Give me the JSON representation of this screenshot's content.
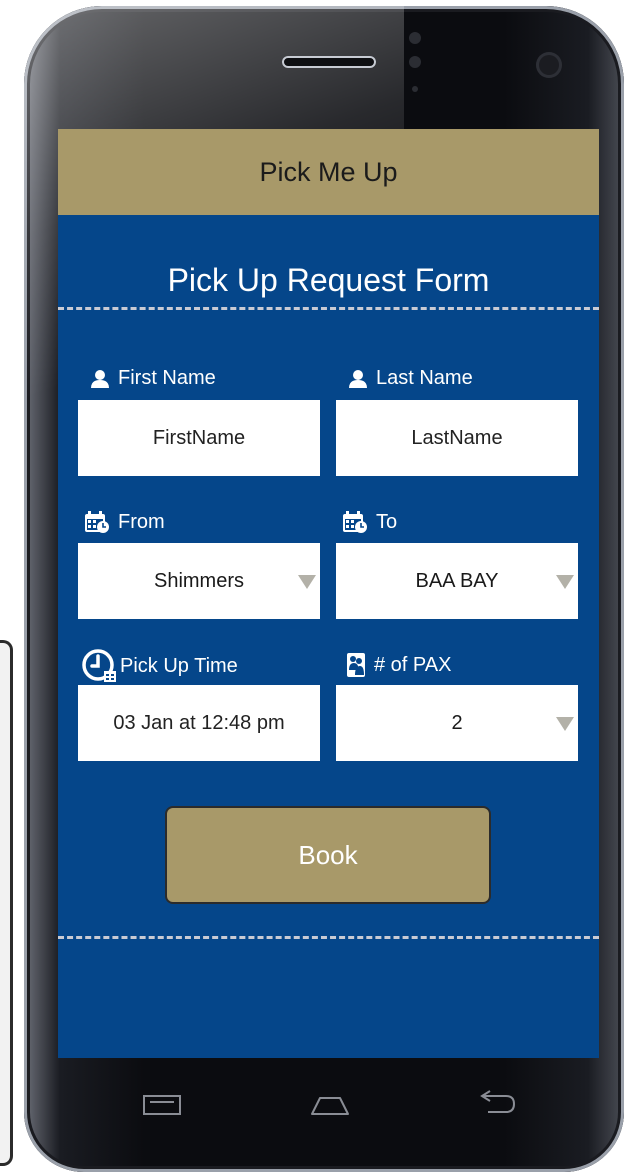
{
  "header": {
    "title": "Pick Me Up"
  },
  "form": {
    "title": "Pick Up Request Form",
    "first_name": {
      "label": "First Name",
      "placeholder": "FirstName"
    },
    "last_name": {
      "label": "Last Name",
      "placeholder": "LastName"
    },
    "from": {
      "label": "From",
      "value": "Shimmers"
    },
    "to": {
      "label": "To",
      "value": "BAA BAY"
    },
    "pickup_time": {
      "label": "Pick Up Time",
      "value": "03 Jan at 12:48 pm"
    },
    "pax": {
      "label": "# of PAX",
      "value": "2"
    },
    "book_label": "Book"
  },
  "colors": {
    "header": "#a89969",
    "screen_bg": "#05468a",
    "button": "#a89969"
  },
  "icons": {
    "name": "person-icon",
    "location": "calendar-icon",
    "time": "clock-icon",
    "pax": "people-icon"
  }
}
